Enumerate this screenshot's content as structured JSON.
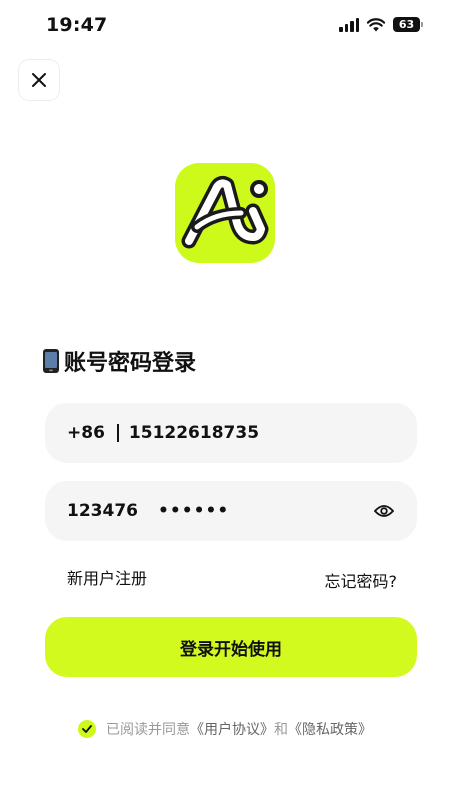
{
  "status_bar": {
    "time": "19:47",
    "battery": "63"
  },
  "login": {
    "title": "账号密码登录",
    "phone": {
      "country_code": "+86",
      "number": "15122618735"
    },
    "password": {
      "value": "123476",
      "mask": "••••••"
    },
    "register_label": "新用户注册",
    "forgot_label": "忘记密码?",
    "submit_label": "登录开始使用"
  },
  "agreement": {
    "prefix": "已阅读并同意",
    "user_agreement": "《用户协议》",
    "conjunction": "和",
    "privacy_policy": "《隐私政策》",
    "checked": true
  },
  "colors": {
    "accent": "#d2fa1e",
    "field_bg": "#f5f5f5",
    "muted_text": "#999999"
  },
  "icons": [
    "close-icon",
    "app-logo",
    "phone-icon",
    "eye-icon",
    "check-icon",
    "wifi-icon",
    "signal-icon"
  ]
}
